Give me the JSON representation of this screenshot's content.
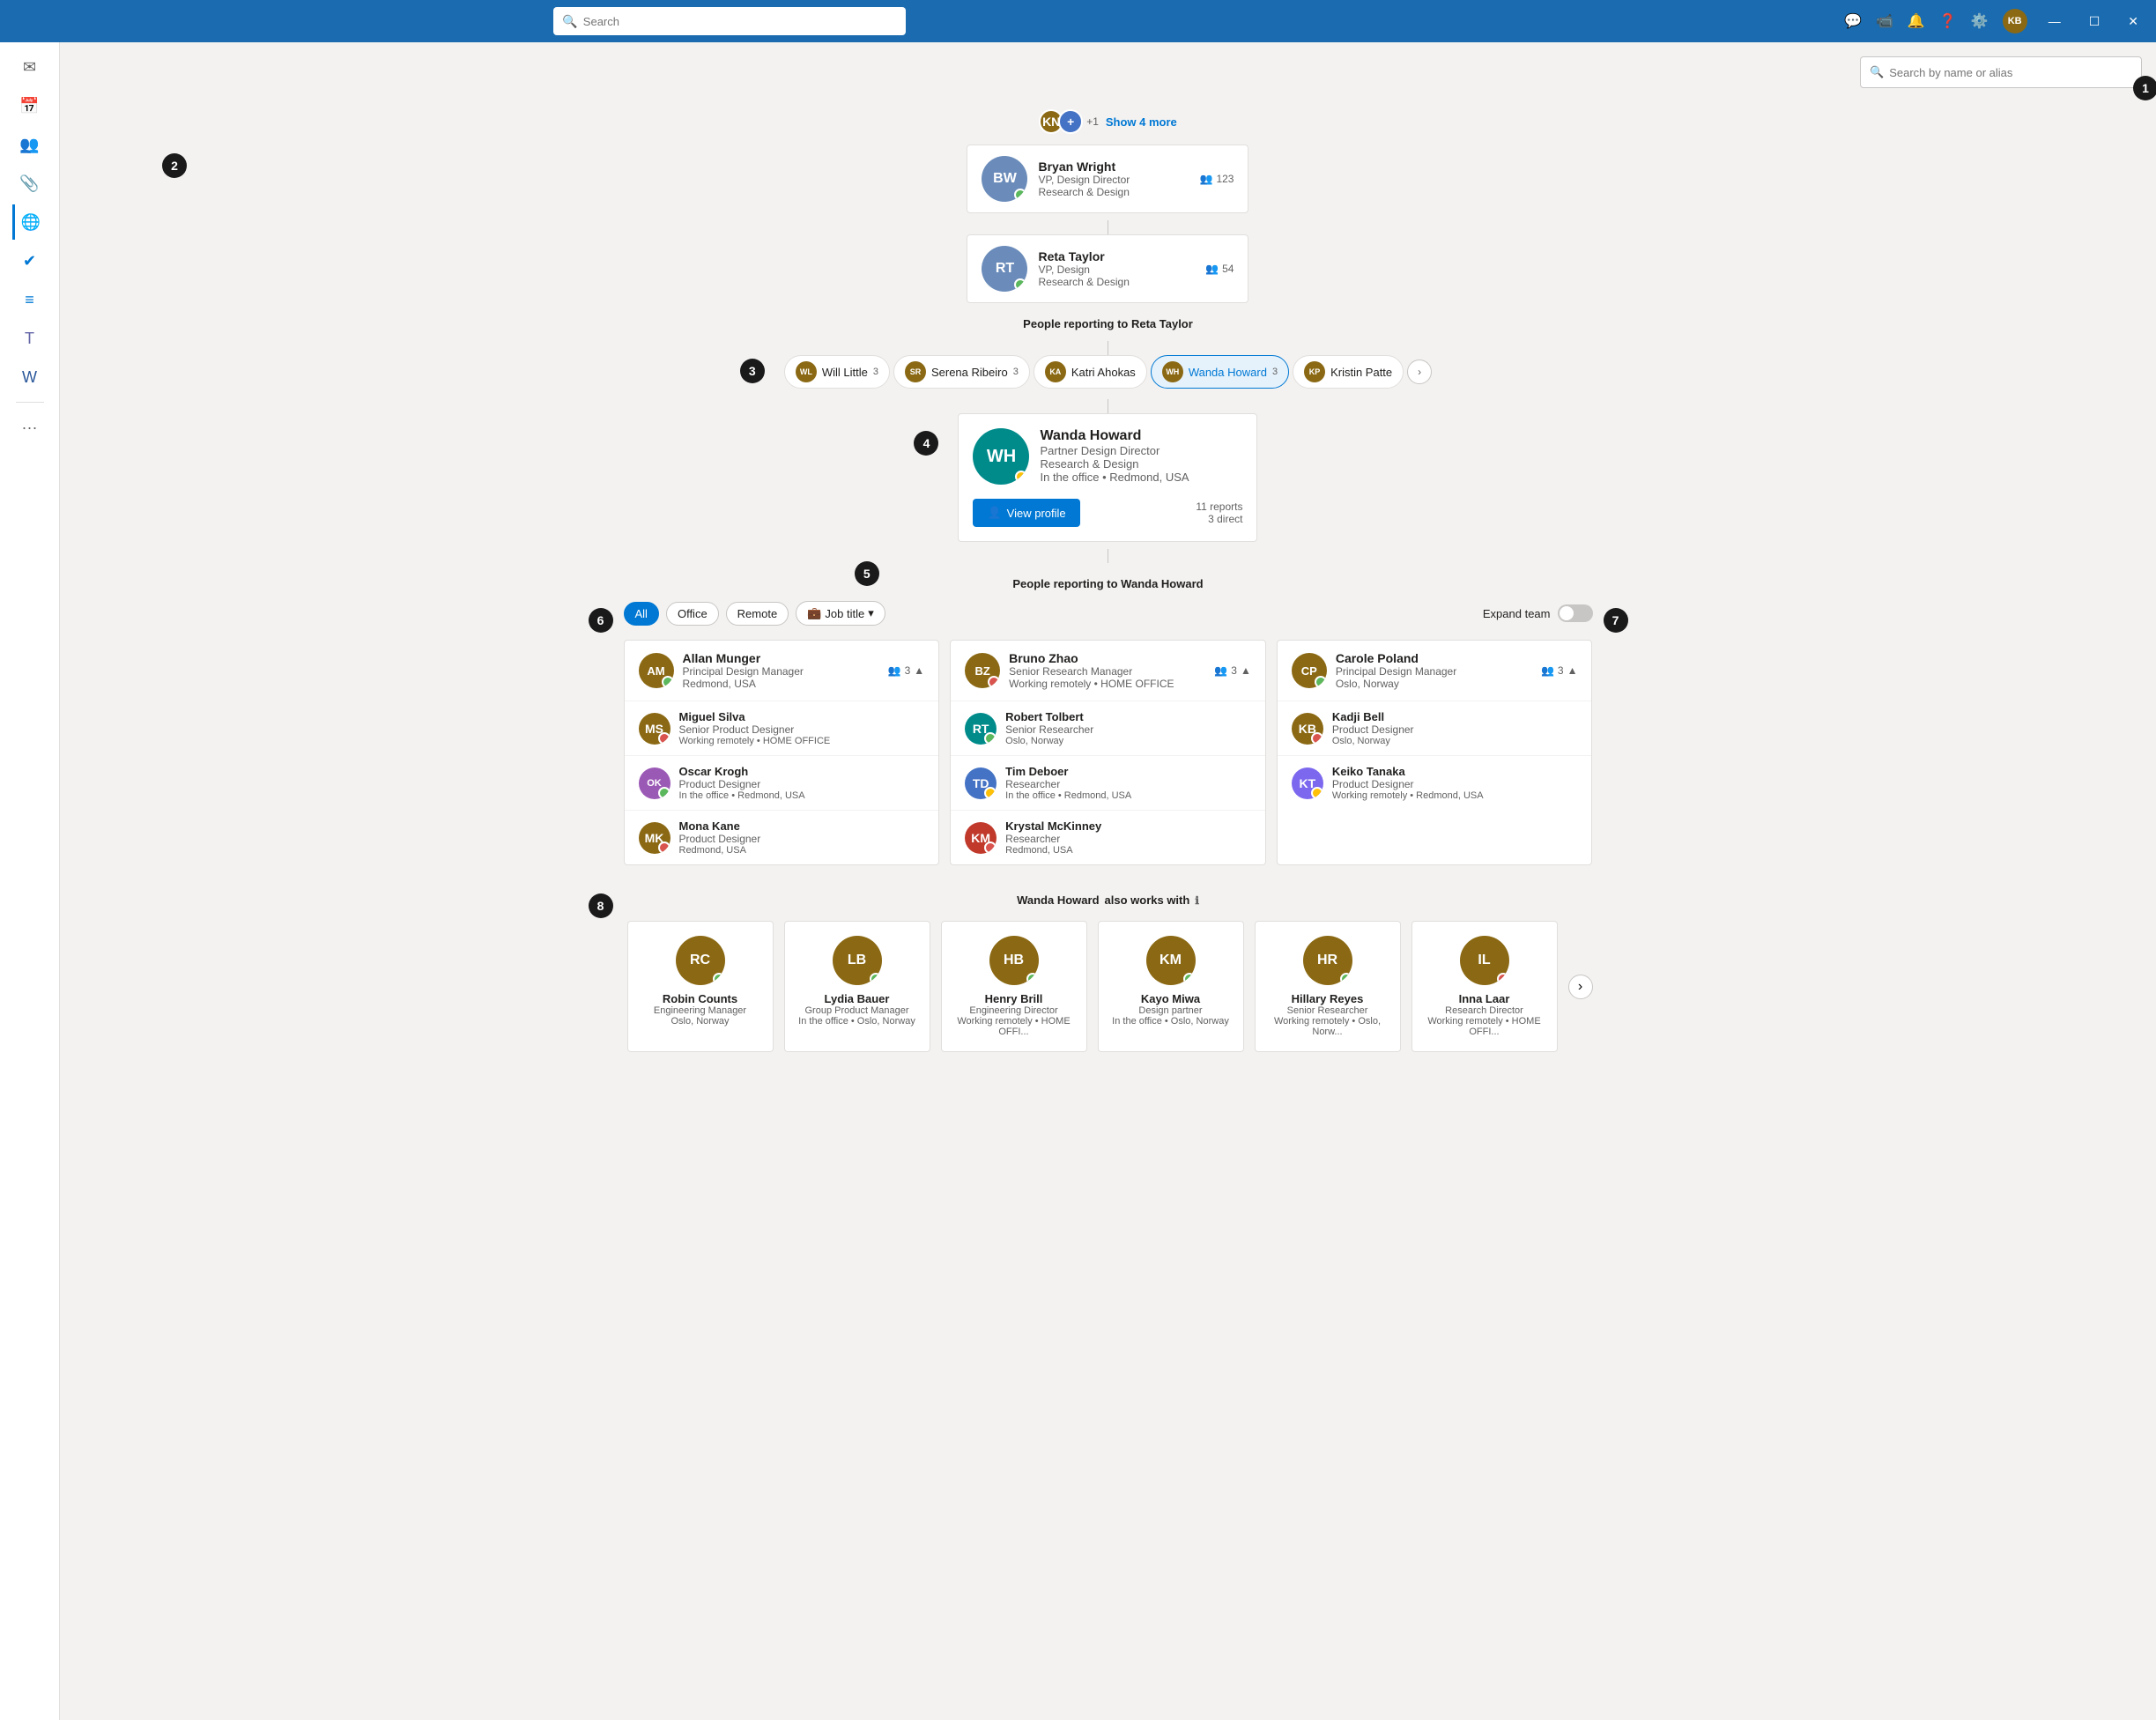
{
  "titlebar": {
    "search_placeholder": "Search",
    "icons": [
      "chat",
      "video",
      "bell",
      "help",
      "settings"
    ],
    "user_initials": "KB",
    "min": "—",
    "restore": "☐",
    "close": "✕"
  },
  "top_search": {
    "placeholder": "Search by name or alias"
  },
  "annotations": [
    "1",
    "2",
    "3",
    "4",
    "5",
    "6",
    "7",
    "8"
  ],
  "show_more": {
    "count": "+1",
    "label": "Show 4 more"
  },
  "manager_chain": [
    {
      "name": "Bryan Wright",
      "title": "VP, Design Director",
      "dept": "Research & Design",
      "count": "123",
      "status": "available",
      "initials": "BW",
      "color": "av-blue"
    },
    {
      "name": "Reta Taylor",
      "title": "VP, Design",
      "dept": "Research & Design",
      "count": "54",
      "status": "available",
      "initials": "RT",
      "color": "av-teal"
    }
  ],
  "reporting_to_reta": "People reporting to",
  "reta_name": "Reta Taylor",
  "reporter_tabs": [
    {
      "name": "Will Little",
      "count": "3",
      "initials": "WL",
      "color": "av-brown"
    },
    {
      "name": "Serena Ribeiro",
      "count": "3",
      "initials": "SR",
      "color": "av-purple"
    },
    {
      "name": "Katri Ahokas",
      "count": "",
      "initials": "KA",
      "color": "av-blue"
    },
    {
      "name": "Wanda Howard",
      "count": "3",
      "initials": "WH",
      "color": "av-teal",
      "active": true
    },
    {
      "name": "Kristin Patte",
      "count": "",
      "initials": "KP",
      "color": "av-pink"
    }
  ],
  "selected_person": {
    "name": "Wanda Howard",
    "title": "Partner Design Director",
    "dept": "Research & Design",
    "location": "In the office • Redmond, USA",
    "status": "away",
    "initials": "WH",
    "color": "av-teal",
    "reports": "11 reports",
    "direct": "3 direct",
    "view_profile": "View profile"
  },
  "reporting_to_wanda": "People reporting to",
  "wanda_name": "Wanda Howard",
  "filter_tabs": [
    {
      "label": "All",
      "active": true
    },
    {
      "label": "Office",
      "active": false
    },
    {
      "label": "Remote",
      "active": false
    }
  ],
  "job_title_filter": "Job title",
  "expand_team": "Expand team",
  "team_columns": [
    {
      "manager": {
        "name": "Allan Munger",
        "title": "Principal Design Manager",
        "location": "Redmond, USA",
        "count": "3",
        "status": "available",
        "initials": "AM",
        "color": "av-gray"
      },
      "members": [
        {
          "name": "Miguel Silva",
          "title": "Senior Product Designer",
          "location": "Working remotely • HOME OFFICE",
          "status": "busy",
          "initials": "MS",
          "color": "av-brown"
        },
        {
          "name": "Oscar Krogh",
          "title": "Product Designer",
          "location": "In the office • Redmond, USA",
          "status": "available",
          "initials": "OK",
          "color": "av-lilac"
        },
        {
          "name": "Mona Kane",
          "title": "Product Designer",
          "location": "Redmond, USA",
          "status": "busy",
          "initials": "MK",
          "color": "av-brown"
        }
      ]
    },
    {
      "manager": {
        "name": "Bruno Zhao",
        "title": "Senior Research Manager",
        "location": "Working remotely • HOME OFFICE",
        "count": "3",
        "status": "busy",
        "initials": "BZ",
        "color": "av-brown"
      },
      "members": [
        {
          "name": "Robert Tolbert",
          "title": "Senior Researcher",
          "location": "Oslo, Norway",
          "status": "available",
          "initials": "RT",
          "color": "av-teal"
        },
        {
          "name": "Tim Deboer",
          "title": "Researcher",
          "location": "In the office • Redmond, USA",
          "status": "away",
          "initials": "TD",
          "color": "av-blue"
        },
        {
          "name": "Krystal McKinney",
          "title": "Researcher",
          "location": "Redmond, USA",
          "status": "busy",
          "initials": "KM",
          "color": "av-red"
        }
      ]
    },
    {
      "manager": {
        "name": "Carole Poland",
        "title": "Principal Design Manager",
        "location": "Oslo, Norway",
        "count": "3",
        "status": "available",
        "initials": "CP",
        "color": "av-gray"
      },
      "members": [
        {
          "name": "Kadji Bell",
          "title": "Product Designer",
          "location": "Oslo, Norway",
          "status": "busy",
          "initials": "KB",
          "color": "av-brown"
        },
        {
          "name": "Keiko Tanaka",
          "title": "Product Designer",
          "location": "Working remotely • Redmond, USA",
          "status": "away",
          "initials": "KT",
          "color": "av-purple"
        }
      ]
    }
  ],
  "also_works_with": "also works with",
  "also_works_person": "Wanda Howard",
  "collaborators": [
    {
      "name": "Robin Counts",
      "title": "Engineering Manager",
      "location": "Oslo, Norway",
      "initials": "RC",
      "color": "av-brown",
      "status": "available"
    },
    {
      "name": "Lydia Bauer",
      "title": "Group Product Manager",
      "location": "In the office • Oslo, Norway",
      "initials": "LB",
      "color": "av-teal",
      "status": "available"
    },
    {
      "name": "Henry Brill",
      "title": "Engineering Director",
      "location": "Working remotely • HOME OFFI...",
      "initials": "HB",
      "color": "av-blue",
      "status": "available"
    },
    {
      "name": "Kayo Miwa",
      "title": "Design partner",
      "location": "In the office • Oslo, Norway",
      "initials": "KM",
      "color": "av-pink",
      "status": "available"
    },
    {
      "name": "Hillary Reyes",
      "title": "Senior Researcher",
      "location": "Working remotely • Oslo, Norw...",
      "initials": "HR",
      "color": "av-brown",
      "status": "available"
    },
    {
      "name": "Inna Laar",
      "title": "Research Director",
      "location": "Working remotely • HOME OFFI...",
      "initials": "IL",
      "color": "av-lilac",
      "status": "busy"
    }
  ]
}
